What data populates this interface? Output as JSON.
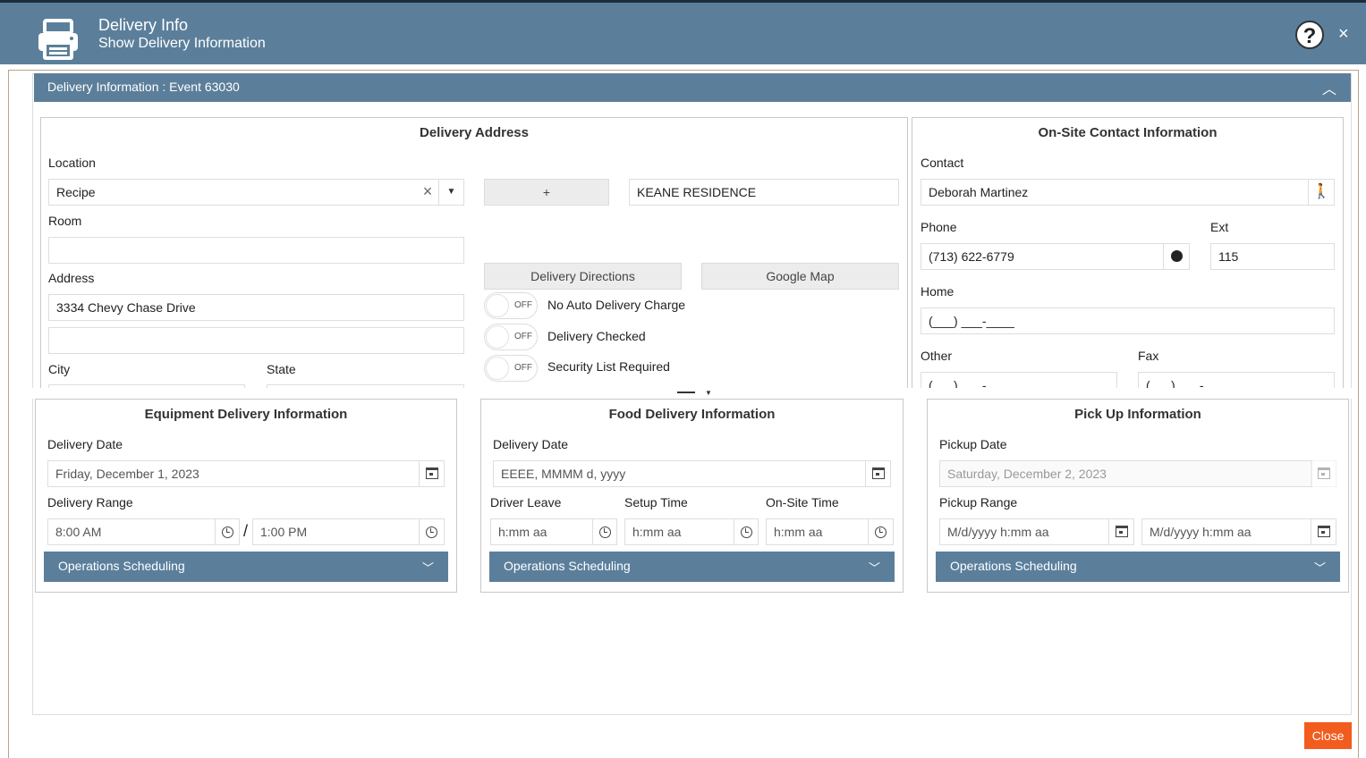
{
  "header": {
    "title": "Delivery Info",
    "subtitle": "Show Delivery Information",
    "help": "?",
    "close": "×"
  },
  "section_bar": {
    "title": "Delivery Information : Event 63030",
    "collapse_icon": "chevron-up-icon"
  },
  "delivery_address": {
    "title": "Delivery Address",
    "location_label": "Location",
    "location_value": "Recipe",
    "add_button": "+",
    "location_name": "KEANE RESIDENCE",
    "room_label": "Room",
    "room_value": "",
    "address_label": "Address",
    "address_line1": "3334 Chevy Chase Drive",
    "address_line2": "",
    "city_label": "City",
    "state_label": "State",
    "directions_button": "Delivery Directions",
    "map_button": "Google Map",
    "toggles": [
      {
        "state": "OFF",
        "label": "No Auto Delivery Charge"
      },
      {
        "state": "OFF",
        "label": "Delivery Checked"
      },
      {
        "state": "OFF",
        "label": "Security List Required"
      }
    ]
  },
  "contact": {
    "title": "On-Site Contact Information",
    "contact_label": "Contact",
    "contact_value": "Deborah Martinez",
    "phone_label": "Phone",
    "phone_value": "(713) 622-6779",
    "ext_label": "Ext",
    "ext_value": "115",
    "home_label": "Home",
    "home_value": "(___) ___-____",
    "other_label": "Other",
    "other_value": "(___) ___-____",
    "fax_label": "Fax",
    "fax_value": "(___) ___-____"
  },
  "equipment": {
    "title": "Equipment Delivery Information",
    "date_label": "Delivery Date",
    "date_value": "Friday, December 1, 2023",
    "range_label": "Delivery Range",
    "range_start": "8:00 AM",
    "range_sep": "/",
    "range_end": "1:00 PM",
    "ops": "Operations Scheduling"
  },
  "food": {
    "title": "Food Delivery Information",
    "date_label": "Delivery Date",
    "date_placeholder": "EEEE, MMMM d, yyyy",
    "driver_label": "Driver Leave",
    "setup_label": "Setup Time",
    "onsite_label": "On-Site Time",
    "time_placeholder": "h:mm aa",
    "ops": "Operations Scheduling"
  },
  "pickup": {
    "title": "Pick Up Information",
    "date_label": "Pickup Date",
    "date_value": "Saturday, December 2, 2023",
    "range_label": "Pickup Range",
    "range_placeholder": "M/d/yyyy h:mm aa",
    "ops": "Operations Scheduling"
  },
  "footer": {
    "close": "Close"
  },
  "colors": {
    "header": "#5b7f9b",
    "close_button": "#f25c1f"
  }
}
